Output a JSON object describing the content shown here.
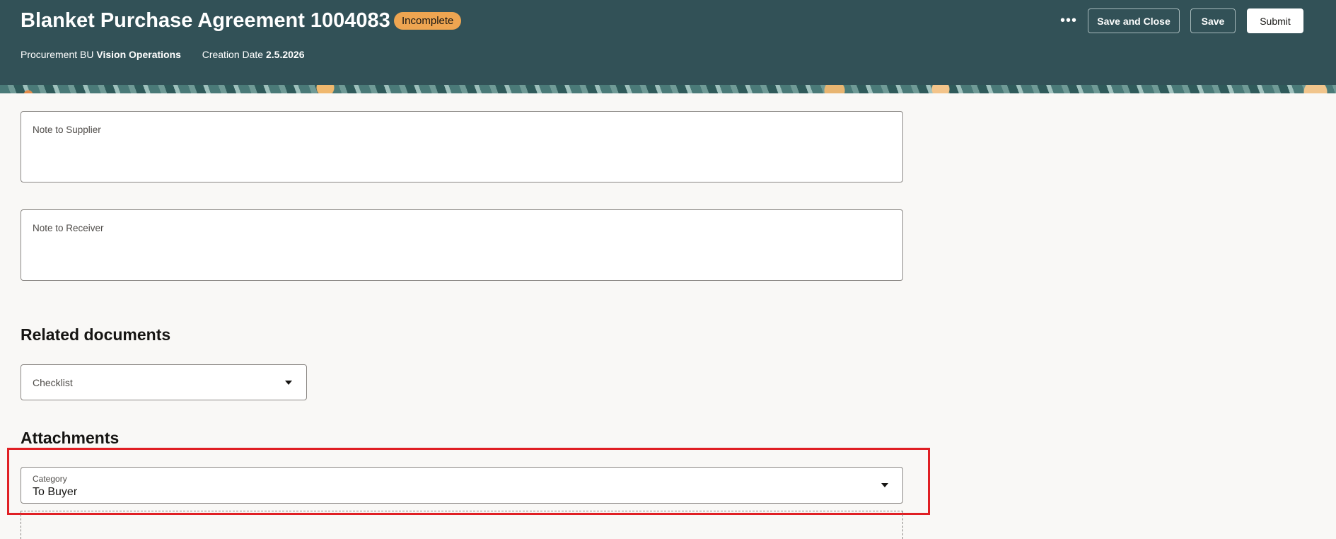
{
  "header": {
    "title": "Blanket Purchase Agreement 1004083",
    "status": "Incomplete",
    "procurement_bu_label": "Procurement BU",
    "procurement_bu_value": "Vision Operations",
    "creation_date_label": "Creation Date",
    "creation_date_value": "2.5.2026",
    "more_label": "•••",
    "save_and_close_label": "Save and Close",
    "save_label": "Save",
    "submit_label": "Submit"
  },
  "notes": {
    "supplier_label": "Note to Supplier",
    "supplier_value": "",
    "receiver_label": "Note to Receiver",
    "receiver_value": ""
  },
  "related_documents": {
    "heading": "Related documents",
    "select_value": "Checklist"
  },
  "attachments": {
    "heading": "Attachments",
    "category_label": "Category",
    "category_value": "To Buyer"
  }
}
